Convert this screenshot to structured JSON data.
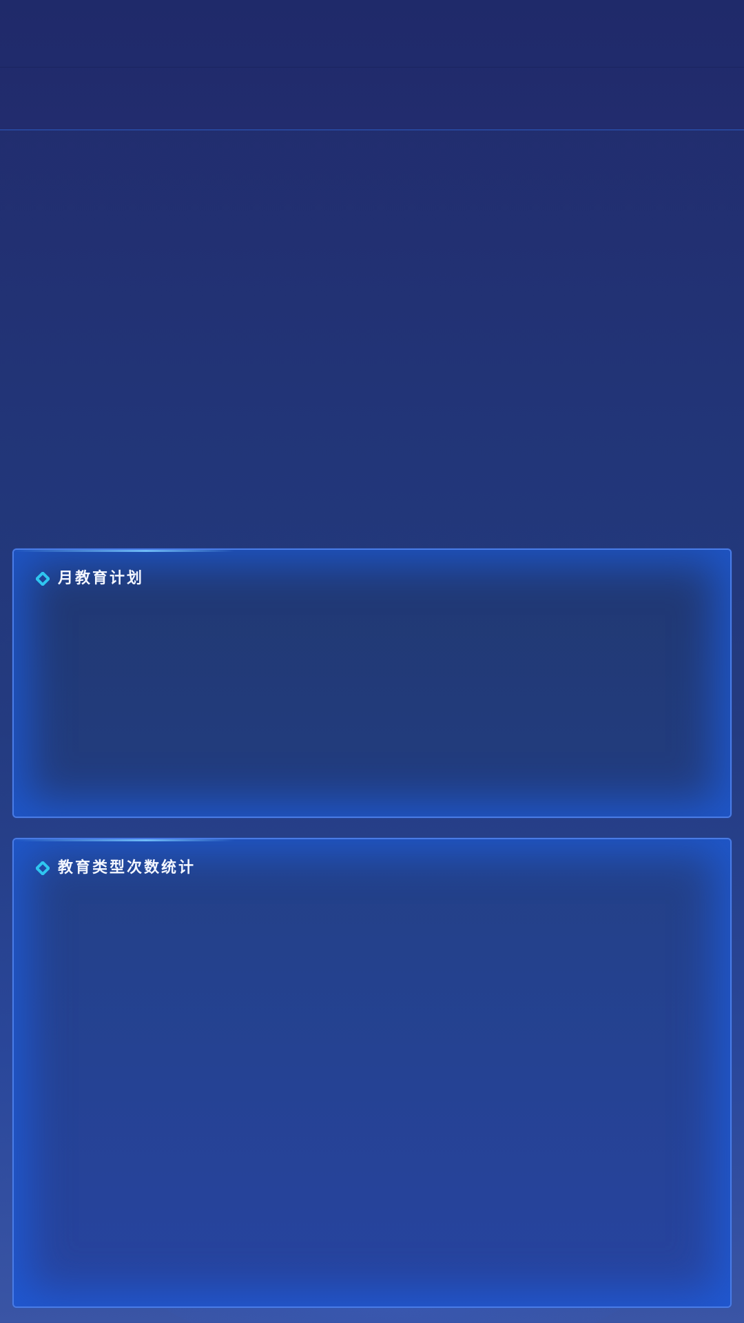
{
  "panels": [
    {
      "title": "月教育计划",
      "icon": "diamond-icon"
    },
    {
      "title": "教育类型次数统计",
      "icon": "diamond-icon"
    }
  ],
  "colors": {
    "background_top": "#212a6b",
    "background_bottom": "#3a55a5",
    "panel_border": "#4a7ce6",
    "panel_glow": "#1e5fe1",
    "icon_accent": "#2fc6f0",
    "title_text": "#f3f6ff"
  }
}
